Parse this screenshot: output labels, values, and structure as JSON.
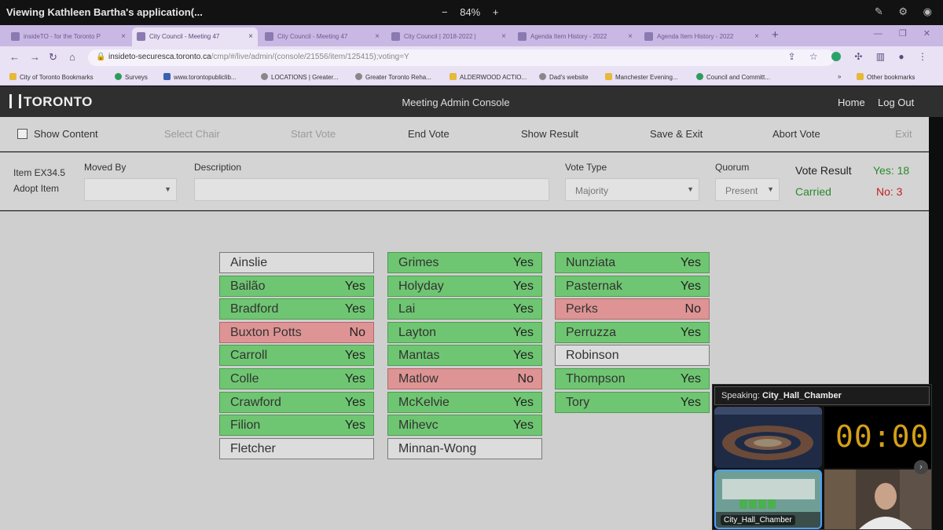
{
  "share": {
    "title": "Viewing Kathleen Bartha's application(...",
    "zoom_minus": "−",
    "zoom_level": "84%",
    "zoom_plus": "+"
  },
  "browser": {
    "tabs": [
      {
        "label": "insideTO - for the Toronto P",
        "active": false
      },
      {
        "label": "City Council - Meeting 47",
        "active": true
      },
      {
        "label": "City Council - Meeting 47",
        "active": false
      },
      {
        "label": "City Council | 2018-2022 |",
        "active": false
      },
      {
        "label": "Agenda Item History - 2022",
        "active": false
      },
      {
        "label": "Agenda Item History - 2022",
        "active": false
      }
    ],
    "url_host": "insideto-securesca.toronto.ca",
    "url_path": "/cmp/#/live/admin/(console/21556/item/125415);voting=Y",
    "bookmarks": [
      {
        "label": "City of Toronto Bookmarks",
        "icon": "folder"
      },
      {
        "label": "Surveys",
        "icon": "green"
      },
      {
        "label": "www.torontopubliclib...",
        "icon": "blue"
      },
      {
        "label": "LOCATIONS | Greater...",
        "icon": "globe"
      },
      {
        "label": "Greater Toronto Reha...",
        "icon": "globe"
      },
      {
        "label": "ALDERWOOD ACTIO...",
        "icon": "folder"
      },
      {
        "label": "Dad's website",
        "icon": "globe"
      },
      {
        "label": "Manchester Evening...",
        "icon": "folder"
      },
      {
        "label": "Council and Committ...",
        "icon": "green"
      },
      {
        "label": "Other bookmarks",
        "icon": "folder"
      }
    ],
    "bookmarks_more": "»"
  },
  "app": {
    "logo": "TORONTO",
    "title": "Meeting Admin Console",
    "home": "Home",
    "logout": "Log Out"
  },
  "actions": {
    "show_content": "Show Content",
    "select_chair": "Select Chair",
    "start_vote": "Start Vote",
    "end_vote": "End Vote",
    "show_result": "Show Result",
    "save_exit": "Save & Exit",
    "abort_vote": "Abort Vote",
    "exit": "Exit"
  },
  "item": {
    "id": "Item EX34.5",
    "action": "Adopt Item",
    "moved_by_label": "Moved By",
    "moved_by_value": "",
    "description_label": "Description",
    "description_value": "",
    "vote_type_label": "Vote Type",
    "vote_type_value": "Majority",
    "quorum_label": "Quorum",
    "quorum_value": "Present",
    "result_label": "Vote Result",
    "result_value": "Carried",
    "yes_count": "Yes: 18",
    "no_count": "No: 3"
  },
  "votes": {
    "col1": [
      {
        "name": "Ainslie",
        "vote": ""
      },
      {
        "name": "Bailão",
        "vote": "Yes"
      },
      {
        "name": "Bradford",
        "vote": "Yes"
      },
      {
        "name": "Buxton Potts",
        "vote": "No"
      },
      {
        "name": "Carroll",
        "vote": "Yes"
      },
      {
        "name": "Colle",
        "vote": "Yes"
      },
      {
        "name": "Crawford",
        "vote": "Yes"
      },
      {
        "name": "Filion",
        "vote": "Yes"
      },
      {
        "name": "Fletcher",
        "vote": ""
      }
    ],
    "col2": [
      {
        "name": "Grimes",
        "vote": "Yes"
      },
      {
        "name": "Holyday",
        "vote": "Yes"
      },
      {
        "name": "Lai",
        "vote": "Yes"
      },
      {
        "name": "Layton",
        "vote": "Yes"
      },
      {
        "name": "Mantas",
        "vote": "Yes"
      },
      {
        "name": "Matlow",
        "vote": "No"
      },
      {
        "name": "McKelvie",
        "vote": "Yes"
      },
      {
        "name": "Mihevc",
        "vote": "Yes"
      },
      {
        "name": "Minnan-Wong",
        "vote": ""
      }
    ],
    "col3": [
      {
        "name": "Nunziata",
        "vote": "Yes"
      },
      {
        "name": "Pasternak",
        "vote": "Yes"
      },
      {
        "name": "Perks",
        "vote": "No"
      },
      {
        "name": "Perruzza",
        "vote": "Yes"
      },
      {
        "name": "Robinson",
        "vote": ""
      },
      {
        "name": "Thompson",
        "vote": "Yes"
      },
      {
        "name": "Tory",
        "vote": "Yes"
      }
    ]
  },
  "video": {
    "speaking_label": "Speaking:",
    "speaking_name": "City_Hall_Chamber",
    "clock": "00:00",
    "tile_label": "City_Hall_Chamber"
  },
  "colors": {
    "yes": "#6fc672",
    "no": "#de9494",
    "none": "#dcdcdc",
    "carried": "#2a8a2a",
    "no_count": "#c02020"
  }
}
